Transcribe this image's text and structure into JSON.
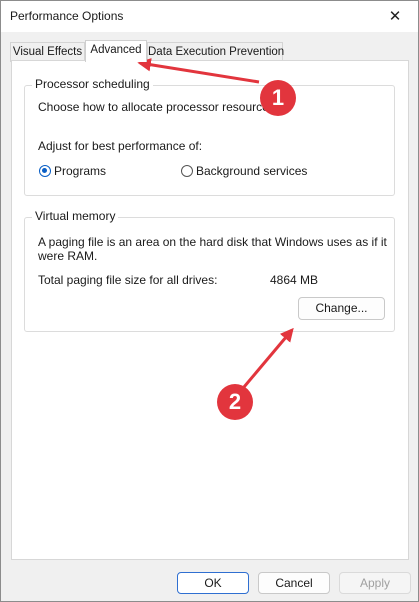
{
  "window": {
    "title": "Performance Options",
    "close_glyph": "✕"
  },
  "tabs": [
    {
      "label": "Visual Effects",
      "active": false
    },
    {
      "label": "Advanced",
      "active": true
    },
    {
      "label": "Data Execution Prevention",
      "active": false
    }
  ],
  "processor_scheduling": {
    "legend": "Processor scheduling",
    "description": "Choose how to allocate processor resources.",
    "adjust_label": "Adjust for best performance of:",
    "options": [
      {
        "label": "Programs",
        "selected": true
      },
      {
        "label": "Background services",
        "selected": false
      }
    ]
  },
  "virtual_memory": {
    "legend": "Virtual memory",
    "description_line1": "A paging file is an area on the hard disk that Windows uses as if it",
    "description_line2": "were RAM.",
    "total_label": "Total paging file size for all drives:",
    "total_value": "4864 MB",
    "change_button": "Change..."
  },
  "footer": {
    "ok": "OK",
    "cancel": "Cancel",
    "apply": "Apply"
  },
  "annotations": {
    "badge1": "1",
    "badge2": "2",
    "color": "#e2353d"
  },
  "colors": {
    "accent": "#0a5fc6",
    "annotation": "#e2353d"
  }
}
